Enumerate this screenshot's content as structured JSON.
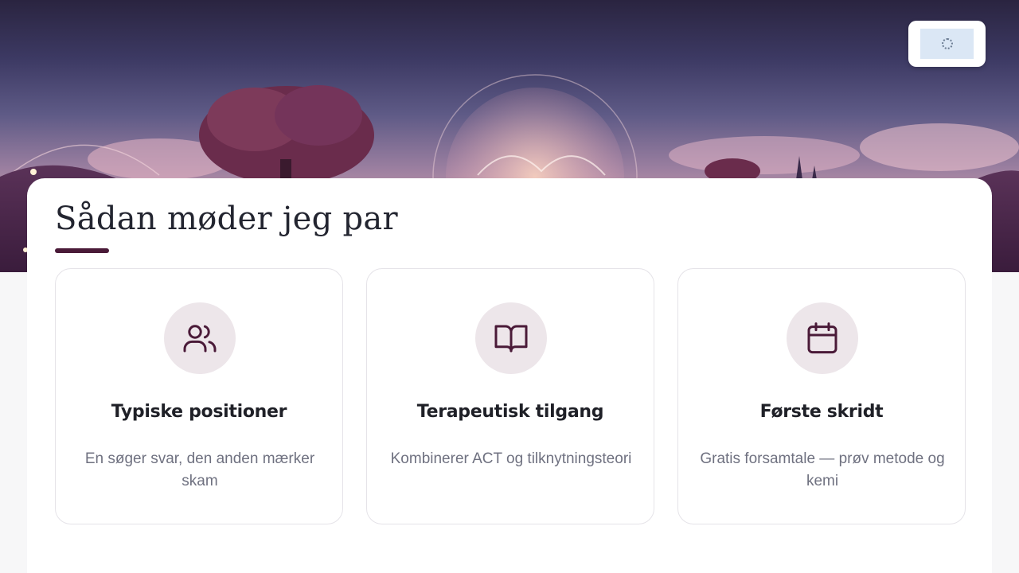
{
  "hero": {
    "widget_icon": "loading-spinner-icon"
  },
  "section": {
    "title": "Sådan møder jeg par"
  },
  "cards": [
    {
      "icon": "users-icon",
      "title": "Typiske positioner",
      "text": "En søger svar, den anden mærker skam"
    },
    {
      "icon": "open-book-icon",
      "title": "Terapeutisk tilgang",
      "text": "Kombinerer ACT og tilknytningsteori"
    },
    {
      "icon": "calendar-icon",
      "title": "Første skridt",
      "text": "Gratis forsamtale — prøv metode og kemi"
    }
  ],
  "colors": {
    "accent": "#4a1a38",
    "icon_bg": "#ede6ea",
    "text_muted": "#6f7180",
    "heading": "#232530"
  }
}
